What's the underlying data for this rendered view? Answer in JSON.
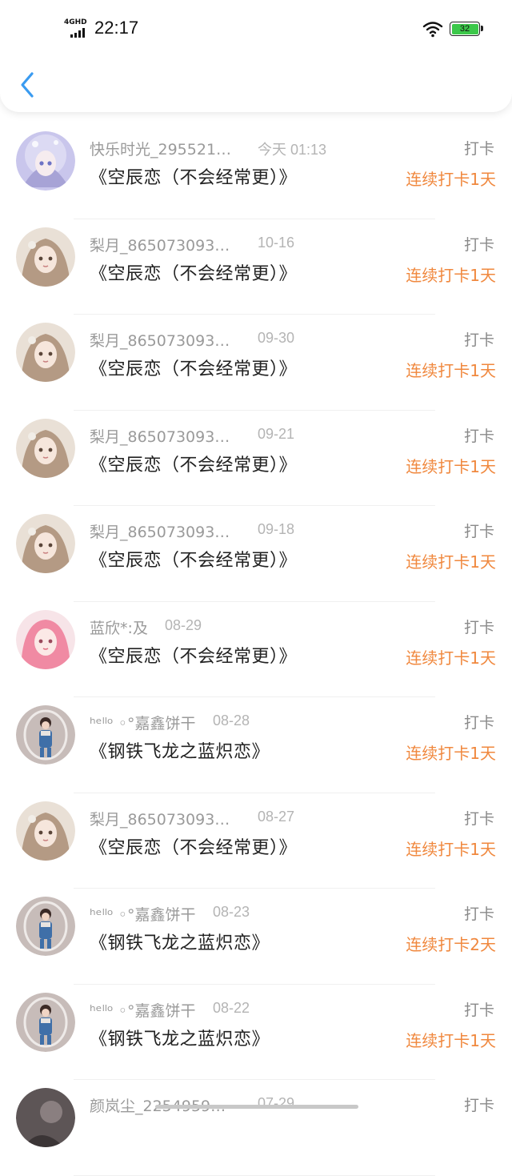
{
  "status_bar": {
    "network": "4GHD",
    "time": "22:17",
    "battery": "32"
  },
  "nav": {
    "back_icon": "chevron-left-icon"
  },
  "colors": {
    "accent": "#f0883e",
    "back": "#3a9bf0",
    "battery_fill": "#3cc84a"
  },
  "list": [
    {
      "name": "快乐时光_295521…",
      "date": "今天  01:13",
      "title": "《空辰恋（不会经常更）》",
      "type": "打卡",
      "streak": "连续打卡1天",
      "avatar": "anime-girl-blue"
    },
    {
      "name": "梨月_865073093…",
      "date": "10-16",
      "title": "《空辰恋（不会经常更）》",
      "type": "打卡",
      "streak": "连续打卡1天",
      "avatar": "doll-girl"
    },
    {
      "name": "梨月_865073093…",
      "date": "09-30",
      "title": "《空辰恋（不会经常更）》",
      "type": "打卡",
      "streak": "连续打卡1天",
      "avatar": "doll-girl"
    },
    {
      "name": "梨月_865073093…",
      "date": "09-21",
      "title": "《空辰恋（不会经常更）》",
      "type": "打卡",
      "streak": "连续打卡1天",
      "avatar": "doll-girl"
    },
    {
      "name": "梨月_865073093…",
      "date": "09-18",
      "title": "《空辰恋（不会经常更）》",
      "type": "打卡",
      "streak": "连续打卡1天",
      "avatar": "doll-girl"
    },
    {
      "name": "蓝欣*:及",
      "date": "08-29",
      "title": "《空辰恋（不会经常更）》",
      "type": "打卡",
      "streak": "连续打卡1天",
      "avatar": "pink-girl"
    },
    {
      "name": "ʰᵉˡˡᵒ  ◦°嘉鑫饼干",
      "date": "08-28",
      "title": "《钢铁飞龙之蓝炽恋》",
      "type": "打卡",
      "streak": "连续打卡1天",
      "avatar": "child-photo"
    },
    {
      "name": "梨月_865073093…",
      "date": "08-27",
      "title": "《空辰恋（不会经常更）》",
      "type": "打卡",
      "streak": "连续打卡1天",
      "avatar": "doll-girl"
    },
    {
      "name": "ʰᵉˡˡᵒ  ◦°嘉鑫饼干",
      "date": "08-23",
      "title": "《钢铁飞龙之蓝炽恋》",
      "type": "打卡",
      "streak": "连续打卡2天",
      "avatar": "child-photo"
    },
    {
      "name": "ʰᵉˡˡᵒ  ◦°嘉鑫饼干",
      "date": "08-22",
      "title": "《钢铁飞龙之蓝炽恋》",
      "type": "打卡",
      "streak": "连续打卡1天",
      "avatar": "child-photo"
    },
    {
      "name": "颜岚尘_2254959…",
      "date": "07-29",
      "title": "",
      "type": "打卡",
      "streak": "",
      "avatar": "dark-photo"
    }
  ]
}
